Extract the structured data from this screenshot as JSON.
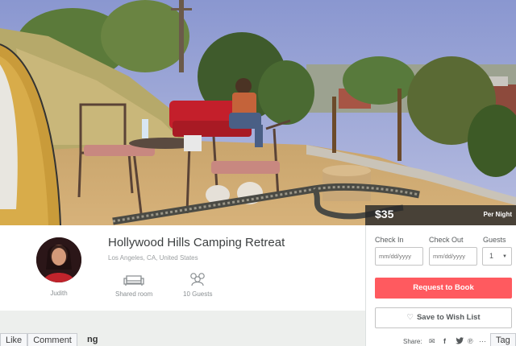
{
  "listing": {
    "price": "$35",
    "per_night": "Per Night",
    "title": "Hollywood Hills Camping Retreat",
    "location": "Los Angeles, CA, United States",
    "host_name": "Judith",
    "amenities": [
      {
        "icon": "sofa-icon",
        "label": "Shared room"
      },
      {
        "icon": "guests-icon",
        "label": "10 Guests"
      }
    ]
  },
  "booking": {
    "check_in_label": "Check In",
    "check_out_label": "Check Out",
    "guests_label": "Guests",
    "check_in_placeholder": "mm/dd/yyyy",
    "check_out_placeholder": "mm/dd/yyyy",
    "guests_value": "1",
    "request_button": "Request to Book",
    "wishlist_button": "Save to Wish List",
    "share_label": "Share:",
    "accent_color": "#ff5a5f"
  },
  "facebook_bar": {
    "like": "Like",
    "comment": "Comment",
    "fragment": "ng",
    "tag": "Tag"
  }
}
